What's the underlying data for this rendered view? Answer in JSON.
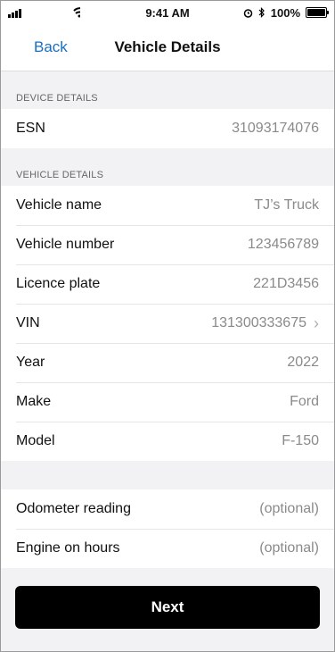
{
  "status": {
    "time": "9:41 AM",
    "battery_percent": "100%",
    "battery_level": 1.0
  },
  "navbar": {
    "back_label": "Back",
    "title": "Vehicle Details"
  },
  "device_details": {
    "header": "DEVICE DETAILS",
    "rows": [
      {
        "label": "ESN",
        "value": "31093174076"
      }
    ]
  },
  "vehicle_details": {
    "header": "VEHICLE DETAILS",
    "rows": [
      {
        "label": "Vehicle name",
        "value": "TJ’s Truck"
      },
      {
        "label": "Vehicle number",
        "value": "123456789"
      },
      {
        "label": "Licence plate",
        "value": "221D3456"
      },
      {
        "label": "VIN",
        "value": "131300333675"
      },
      {
        "label": "Year",
        "value": "2022"
      },
      {
        "label": "Make",
        "value": "Ford"
      },
      {
        "label": "Model",
        "value": "F-150"
      }
    ]
  },
  "optional_details": {
    "rows": [
      {
        "label": "Odometer reading",
        "value": "(optional)"
      },
      {
        "label": "Engine on hours",
        "value": "(optional)"
      }
    ]
  },
  "footer": {
    "next_label": "Next"
  },
  "colors": {
    "accent": "#1b6fbf",
    "button": "#000000"
  }
}
